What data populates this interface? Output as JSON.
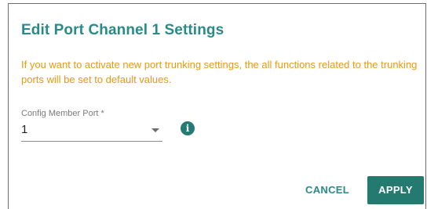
{
  "dialog": {
    "title": "Edit Port Channel 1 Settings",
    "warning": "If you want to activate new port trunking settings, the all functions related to the trunking ports will be set to default values.",
    "field": {
      "label": "Config Member Port *",
      "value": "1"
    },
    "info_icon_glyph": "i",
    "buttons": {
      "cancel": "CANCEL",
      "apply": "APPLY"
    }
  },
  "colors": {
    "title": "#2a8a8a",
    "warning": "#e69a10",
    "apply_bg": "#257a70",
    "info_icon_bg": "#257a74"
  },
  "icons": {
    "dropdown": "chevron-down-icon",
    "info": "info-icon"
  }
}
